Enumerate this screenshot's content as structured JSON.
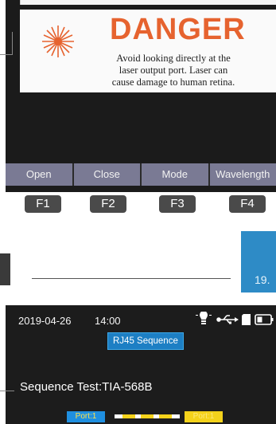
{
  "top_screen": {
    "danger": {
      "title": "DANGER",
      "line1": "Avoid looking directly at the",
      "line2": "laser output port. Laser can",
      "line3": "cause damage to human retina."
    },
    "softkeys": [
      {
        "label": "Open"
      },
      {
        "label": "Close"
      },
      {
        "label": "Mode"
      },
      {
        "label": "Wavelength"
      }
    ],
    "function_buttons": [
      {
        "label": "F1"
      },
      {
        "label": "F2"
      },
      {
        "label": "F3"
      },
      {
        "label": "F4"
      }
    ],
    "icons": {
      "laser": "laser-warning-icon"
    }
  },
  "page": {
    "number": "19."
  },
  "bottom_screen": {
    "status": {
      "date": "2019-04-26",
      "time": "14:00",
      "icons": [
        "lightbulb-icon",
        "usb-icon",
        "sd-card-icon",
        "battery-icon"
      ]
    },
    "title": "RJ45 Sequence",
    "sequence_label": "Sequence Test:TIA-568B",
    "port_left": "Port:1",
    "port_right": "Port:1"
  },
  "colors": {
    "danger_orange": "#e6632f",
    "softkey_bar": "#7a7a94",
    "accent_blue": "#2e8bc6",
    "port_yellow": "#f4d21b"
  }
}
